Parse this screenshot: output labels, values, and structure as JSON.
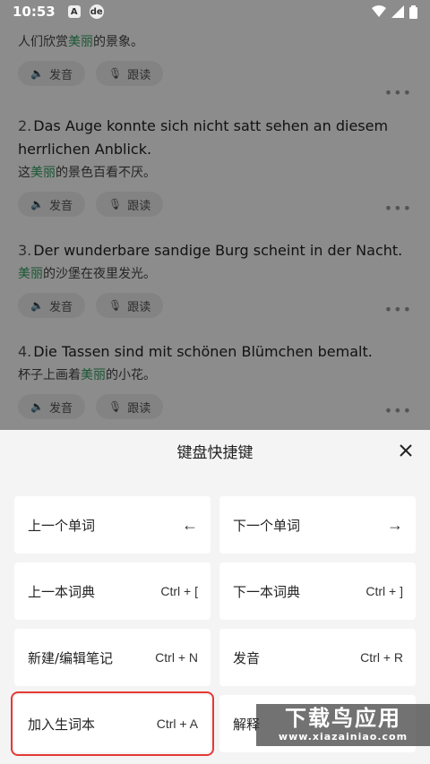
{
  "status_bar": {
    "time": "10:53",
    "notification_icons": [
      "A",
      "de"
    ]
  },
  "sentences": [
    {
      "number": "",
      "german": "",
      "chinese_before": "人们欣赏",
      "chinese_highlight": "美丽",
      "chinese_after": "的景象。",
      "speak_label": "发音",
      "follow_label": "跟读"
    },
    {
      "number": "2.",
      "german": "Das Auge konnte sich nicht satt sehen an diesem herrlichen Anblick.",
      "chinese_before": "这",
      "chinese_highlight": "美丽",
      "chinese_after": "的景色百看不厌。",
      "speak_label": "发音",
      "follow_label": "跟读"
    },
    {
      "number": "3.",
      "german": "Der wunderbare sandige Burg scheint in der Nacht.",
      "chinese_before": "",
      "chinese_highlight": "美丽",
      "chinese_after": "的沙堡在夜里发光。",
      "speak_label": "发音",
      "follow_label": "跟读"
    },
    {
      "number": "4.",
      "german": "Die Tassen sind mit schönen Blümchen bemalt.",
      "chinese_before": "杯子上画着",
      "chinese_highlight": "美丽",
      "chinese_after": "的小花。",
      "speak_label": "发音",
      "follow_label": "跟读"
    }
  ],
  "sheet": {
    "title": "键盘快捷键",
    "shortcuts": [
      {
        "label": "上一个单词",
        "key": "←"
      },
      {
        "label": "下一个单词",
        "key": "→"
      },
      {
        "label": "上一本词典",
        "key": "Ctrl + ["
      },
      {
        "label": "下一本词典",
        "key": "Ctrl + ]"
      },
      {
        "label": "新建/编辑笔记",
        "key": "Ctrl + N"
      },
      {
        "label": "发音",
        "key": "Ctrl + R"
      },
      {
        "label": "加入生词本",
        "key": "Ctrl + A"
      },
      {
        "label": "解释",
        "key": ""
      }
    ]
  },
  "watermark": {
    "text": "下载鸟应用",
    "url": "www.xiazainiao.com"
  },
  "colors": {
    "highlight_word": "#2e9c5c",
    "selected_outline": "#e53935",
    "overlay": "rgba(0,0,0,0.45)"
  }
}
